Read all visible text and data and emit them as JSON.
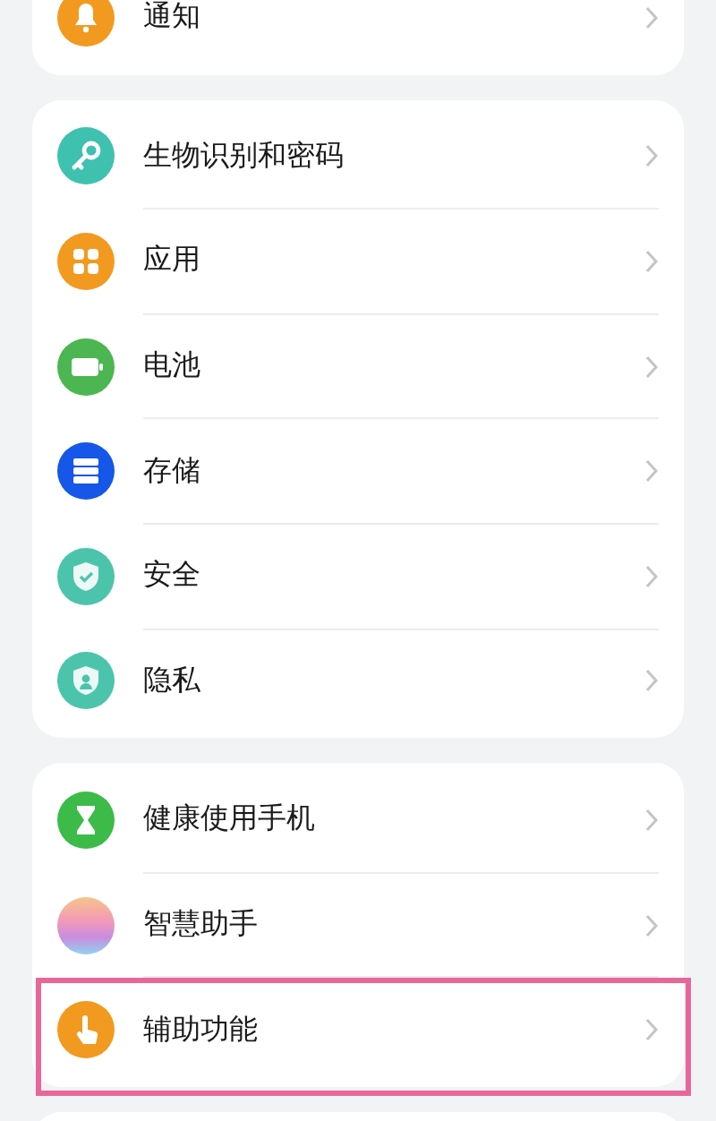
{
  "groups": [
    {
      "items": [
        {
          "label": "通知",
          "kind": "bell",
          "color": "#f29a1f",
          "highlighted": false
        }
      ]
    },
    {
      "items": [
        {
          "label": "生物识别和密码",
          "kind": "key",
          "color": "#3fc1b0",
          "highlighted": false
        },
        {
          "label": "应用",
          "kind": "grid",
          "color": "#f29a1f",
          "highlighted": false
        },
        {
          "label": "电池",
          "kind": "battery",
          "color": "#4cb652",
          "highlighted": false
        },
        {
          "label": "存储",
          "kind": "storage",
          "color": "#1656e8",
          "highlighted": false
        },
        {
          "label": "安全",
          "kind": "shield",
          "color": "#4cc4ac",
          "highlighted": false
        },
        {
          "label": "隐私",
          "kind": "privacy",
          "color": "#4cc4ac",
          "highlighted": false
        }
      ]
    },
    {
      "items": [
        {
          "label": "健康使用手机",
          "kind": "hourglass",
          "color": "#3cbb48",
          "highlighted": false
        },
        {
          "label": "智慧助手",
          "kind": "orb",
          "color": "#c98ce0",
          "highlighted": false
        },
        {
          "label": "辅助功能",
          "kind": "hand",
          "color": "#f29a1f",
          "highlighted": true
        }
      ]
    }
  ]
}
